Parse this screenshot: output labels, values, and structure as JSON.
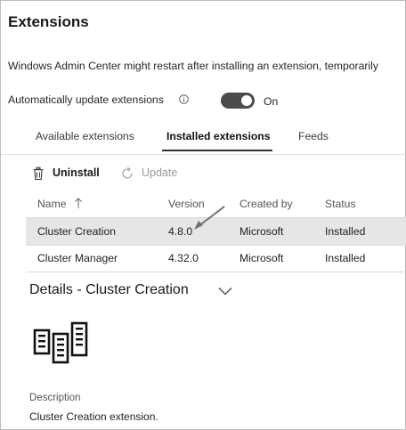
{
  "page": {
    "title": "Extensions",
    "banner": "Windows Admin Center might restart after installing an extension, temporarily"
  },
  "auto_update": {
    "label": "Automatically update extensions",
    "toggle_state": "On",
    "enabled": true
  },
  "tabs": [
    {
      "label": "Available extensions",
      "active": false
    },
    {
      "label": "Installed extensions",
      "active": true
    },
    {
      "label": "Feeds",
      "active": false
    }
  ],
  "toolbar": {
    "uninstall_label": "Uninstall",
    "update_label": "Update",
    "update_enabled": false
  },
  "table": {
    "columns": [
      "Name",
      "Version",
      "Created by",
      "Status"
    ],
    "sort": {
      "column": "Name",
      "direction": "ascending"
    },
    "rows": [
      {
        "name": "Cluster Creation",
        "version": "4.8.0",
        "created_by": "Microsoft",
        "status": "Installed",
        "selected": true
      },
      {
        "name": "Cluster Manager",
        "version": "4.32.0",
        "created_by": "Microsoft",
        "status": "Installed",
        "selected": false
      }
    ]
  },
  "details": {
    "title": "Details - Cluster Creation",
    "icon": "cluster-servers-icon",
    "description_label": "Description",
    "description": "Cluster Creation extension."
  },
  "colors": {
    "accent": "#4a4a4a",
    "selected_row": "#e6e6e6",
    "disabled_text": "#9a9a9a"
  }
}
